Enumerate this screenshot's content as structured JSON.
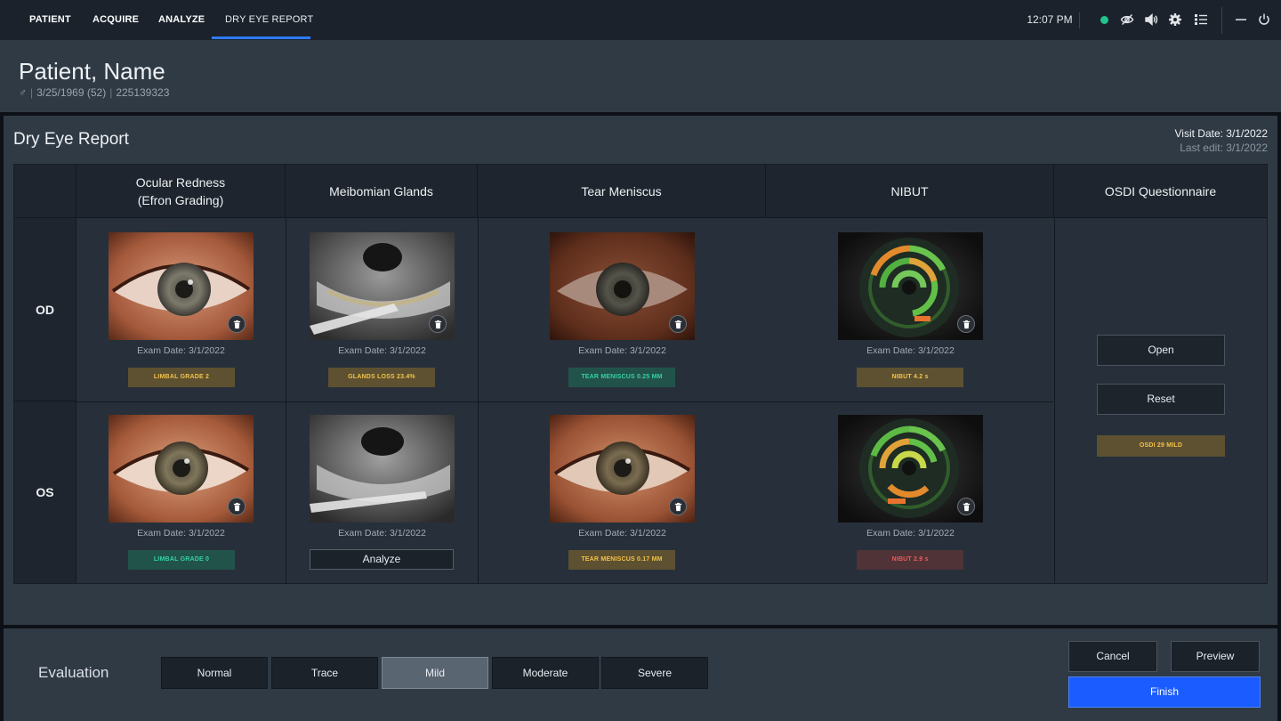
{
  "nav": {
    "tabs": [
      {
        "label": "PATIENT"
      },
      {
        "label": "ACQUIRE"
      },
      {
        "label": "ANALYZE"
      },
      {
        "label": "DRY EYE REPORT",
        "active": true
      }
    ],
    "time": "12:07 PM",
    "status_color": "#22c38e",
    "accent_color": "#2f7bff",
    "icons": [
      "eye-slash-icon",
      "speaker-icon",
      "gear-icon",
      "list-icon",
      "minimize-icon",
      "power-icon"
    ]
  },
  "patient": {
    "name": "Patient, Name",
    "sex_symbol": "♂",
    "dob": "3/25/1969 (52)",
    "id": "225139323"
  },
  "report": {
    "title": "Dry Eye Report",
    "visit_date": "Visit Date: 3/1/2022",
    "last_edit": "Last edit: 3/1/2022",
    "columns": [
      {
        "label": "Ocular Redness",
        "sublabel": "(Efron Grading)"
      },
      {
        "label": "Meibomian Glands"
      },
      {
        "label": "Tear Meniscus"
      },
      {
        "label": "NIBUT"
      },
      {
        "label": "OSDI Questionnaire"
      }
    ],
    "rows": [
      {
        "label": "OD",
        "cells": [
          {
            "exam": "Exam Date: 3/1/2022",
            "badge": "LIMBAL GRADE 2",
            "badge_color": "amber"
          },
          {
            "exam": "Exam Date: 3/1/2022",
            "badge": "GLANDS LOSS 23.4%",
            "badge_color": "amber"
          },
          {
            "exam": "Exam Date: 3/1/2022",
            "badge": "TEAR MENISCUS 0.25 MM",
            "badge_color": "teal"
          },
          {
            "exam": "Exam Date: 3/1/2022",
            "badge": "NIBUT 4.2 s",
            "badge_color": "amber"
          }
        ]
      },
      {
        "label": "OS",
        "cells": [
          {
            "exam": "Exam Date: 3/1/2022",
            "badge": "LIMBAL GRADE 0",
            "badge_color": "teal"
          },
          {
            "exam": "Exam Date: 3/1/2022",
            "action": "Analyze"
          },
          {
            "exam": "Exam Date: 3/1/2022",
            "badge": "TEAR MENISCUS 0.17 MM",
            "badge_color": "amber"
          },
          {
            "exam": "Exam Date: 3/1/2022",
            "badge": "NIBUT 2.9 s",
            "badge_color": "red"
          }
        ]
      }
    ],
    "osdi": {
      "open_label": "Open",
      "reset_label": "Reset",
      "badge": "OSDI 29 MILD"
    }
  },
  "evaluation": {
    "label": "Evaluation",
    "options": [
      "Normal",
      "Trace",
      "Mild",
      "Moderate",
      "Severe"
    ],
    "selected": "Mild"
  },
  "actions": {
    "cancel": "Cancel",
    "preview": "Preview",
    "finish": "Finish"
  }
}
